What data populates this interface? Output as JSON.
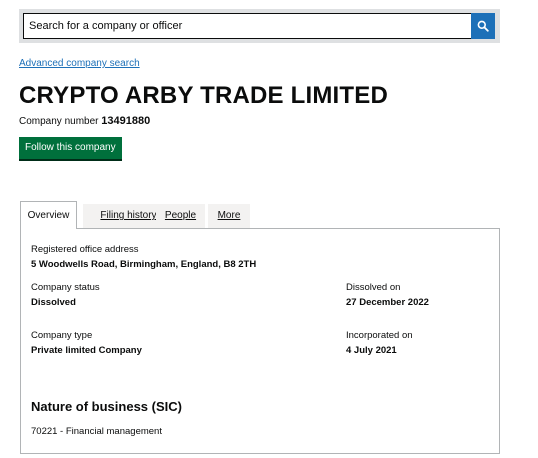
{
  "search": {
    "placeholder": "Search for a company or officer",
    "button_icon": "search-icon",
    "button_color": "#1d70b8"
  },
  "advanced_search_label": "Advanced company search",
  "company": {
    "name": "CRYPTO ARBY TRADE LIMITED",
    "number_label": "Company number",
    "number": "13491880"
  },
  "follow_button_label": "Follow this company",
  "follow_button_color": "#00703c",
  "tabs": [
    {
      "label": "Overview",
      "active": true
    },
    {
      "label": "Filing history",
      "active": false
    },
    {
      "label": "People",
      "active": false
    },
    {
      "label": "More",
      "active": false
    }
  ],
  "overview": {
    "registered_office_label": "Registered office address",
    "registered_office_value": "5 Woodwells Road, Birmingham, England, B8 2TH",
    "status_label": "Company status",
    "status_value": "Dissolved",
    "dissolved_label": "Dissolved on",
    "dissolved_value": "27 December 2022",
    "type_label": "Company type",
    "type_value": "Private limited Company",
    "incorporated_label": "Incorporated on",
    "incorporated_value": "4 July 2021",
    "nature_heading": "Nature of business (SIC)",
    "sic_entry": "70221 - Financial management"
  }
}
